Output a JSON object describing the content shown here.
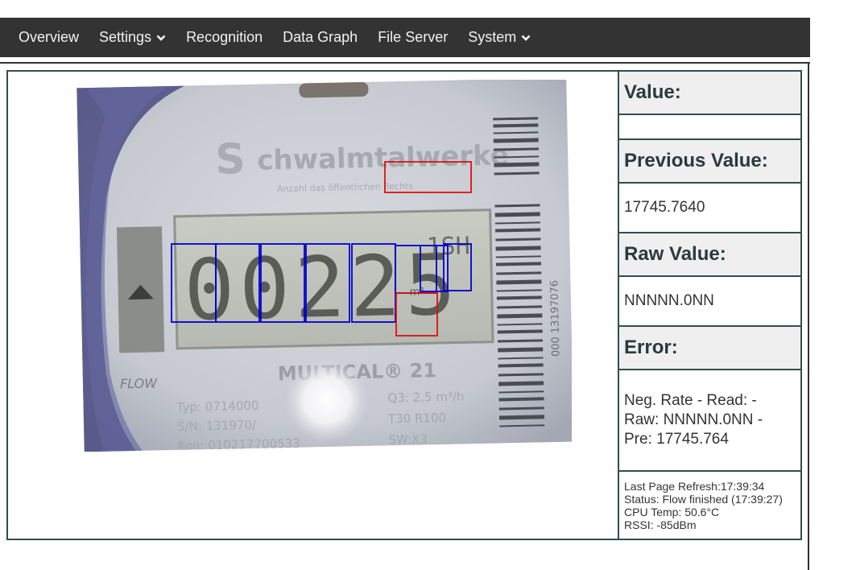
{
  "nav": {
    "items": [
      {
        "label": "Overview"
      },
      {
        "label": "Settings",
        "dropdown": true
      },
      {
        "label": "Recognition"
      },
      {
        "label": "Data Graph"
      },
      {
        "label": "File Server"
      },
      {
        "label": "System",
        "dropdown": true
      }
    ]
  },
  "meter": {
    "brand": "Schwalmtalwerke",
    "brand_sub": "Anzahl das öffentlichen Rechts",
    "digits": "00225",
    "unit": "m³",
    "model": "MULTICAL® 21",
    "flow_label": "FLOW",
    "spec_typ": "Typ: 0714000",
    "spec_sn": "S/N: 131970/",
    "spec_kon": "Kon: 010217700533",
    "spec_q3": "Q3: 2,5 m³/h",
    "spec_t30": "T30  R100",
    "spec_sw": "SW:X3",
    "side_text": "000 13197076"
  },
  "panel": {
    "value_label": "Value:",
    "value": "",
    "previous_label": "Previous Value:",
    "previous_value": "17745.7640",
    "raw_label": "Raw Value:",
    "raw_value": "NNNNN.0NN",
    "error_label": "Error:",
    "error_value": "Neg. Rate - Read: - Raw: NNNNN.0NN - Pre: 17745.764",
    "status": {
      "last_refresh": "Last Page Refresh:17:39:34",
      "status": "Status: Flow finished (17:39:27)",
      "cpu_temp": "CPU Temp: 50.6°C",
      "rssi": "RSSI: -85dBm"
    }
  },
  "colors": {
    "nav_bg": "#333333",
    "roi_digit": "#0000cc",
    "roi_analog": "#dd1111",
    "header_bg": "#efefef",
    "border": "#2f4f4f"
  }
}
